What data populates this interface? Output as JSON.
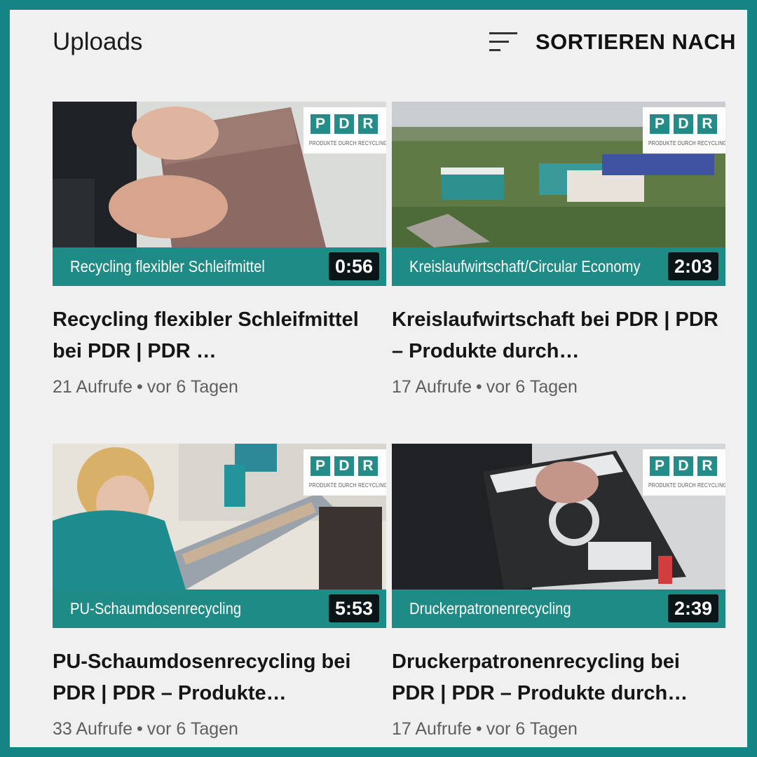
{
  "header": {
    "title": "Uploads",
    "sort_label": "SORTIEREN NACH",
    "sort_icon": "sort-icon"
  },
  "brand": {
    "accent": "#1f8b86",
    "logo_letters": [
      "P",
      "D",
      "R"
    ],
    "logo_sub": "PRODUKTE DURCH RECYCLING"
  },
  "videos": [
    {
      "bar_text": "Recycling flexibler Schleifmittel",
      "duration": "0:56",
      "title": "Recycling flexibler Schleifmittel bei PDR | PDR …",
      "views": "21 Aufrufe",
      "age": "vor 6 Tagen"
    },
    {
      "bar_text": "Kreislaufwirtschaft/Circular Economy",
      "duration": "2:03",
      "title": "Kreislaufwirtschaft bei PDR | PDR – Produkte durch…",
      "views": "17 Aufrufe",
      "age": "vor 6 Tagen"
    },
    {
      "bar_text": "PU-Schaumdosenrecycling",
      "duration": "5:53",
      "title": "PU-Schaumdosenrecycling bei PDR | PDR – Produkte…",
      "views": "33 Aufrufe",
      "age": "vor 6 Tagen"
    },
    {
      "bar_text": "Druckerpatronenrecycling",
      "duration": "2:39",
      "title": "Druckerpatronenrecycling bei PDR | PDR – Produkte durch…",
      "views": "17 Aufrufe",
      "age": "vor 6 Tagen"
    }
  ],
  "meta_separator": "•"
}
